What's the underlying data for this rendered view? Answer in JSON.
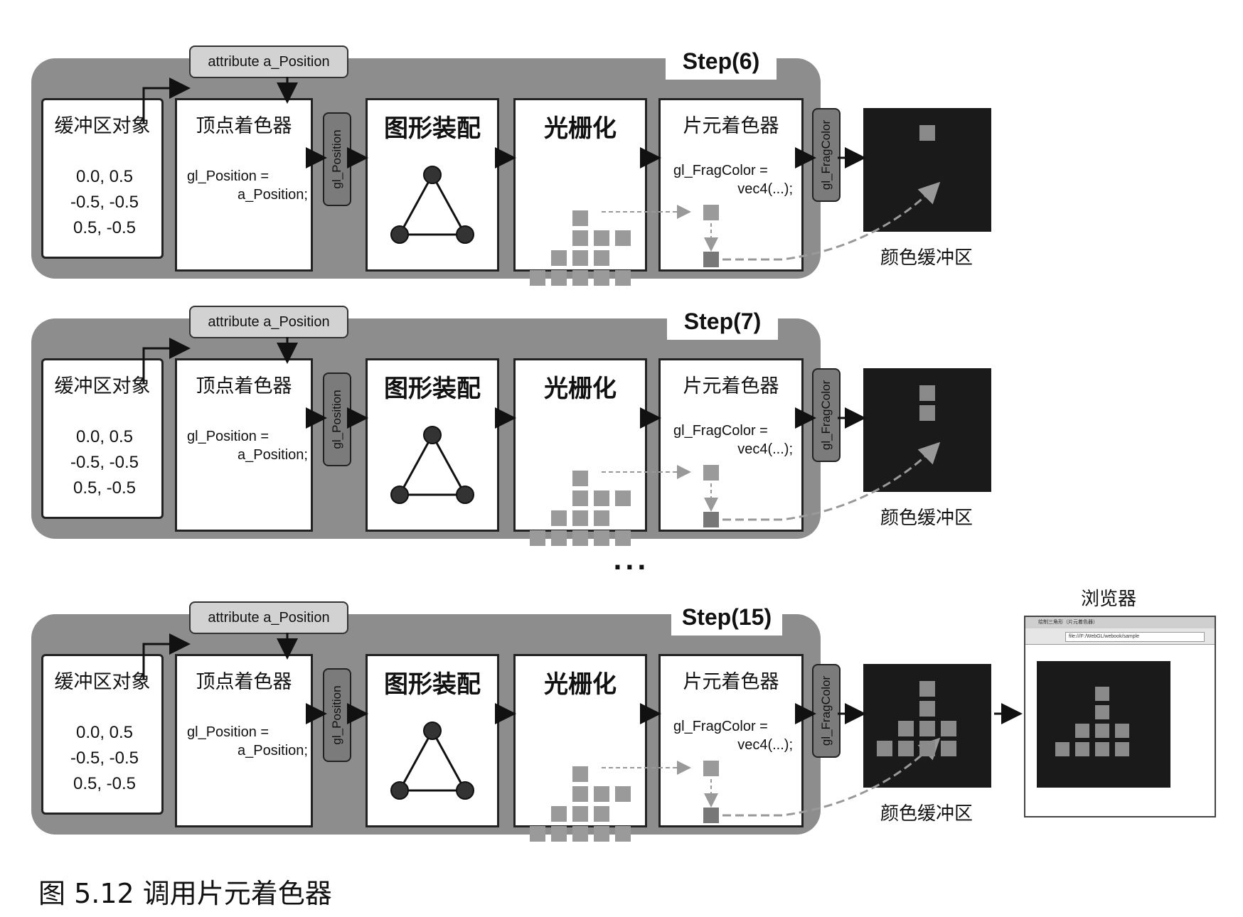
{
  "steps": [
    {
      "label": "Step(6)",
      "fragments_in_buffer": 1
    },
    {
      "label": "Step(7)",
      "fragments_in_buffer": 2
    },
    {
      "label": "Step(15)",
      "fragments_in_buffer": 9
    }
  ],
  "labels": {
    "attribute": "attribute a_Position",
    "buffer_object": "缓冲区对象",
    "buffer_values": [
      "0.0,  0.5",
      "-0.5, -0.5",
      "0.5, -0.5"
    ],
    "vertex_shader": "顶点着色器",
    "vs_code_line1": "gl_Position =",
    "vs_code_line2": "a_Position;",
    "gl_position": "gl_Position",
    "primitive_assembly": "图形装配",
    "rasterization": "光栅化",
    "fragment_shader": "片元着色器",
    "fs_code_line1": "gl_FragColor =",
    "fs_code_line2": "vec4(...);",
    "gl_fragcolor": "gl_FragColor",
    "color_buffer": "颜色缓冲区",
    "browser": "浏览器",
    "browser_tab": "绘制三角形（片元着色器）",
    "browser_url": "file:///F:/WebGL/webook/sample"
  },
  "ellipsis": "...",
  "caption": "图 5.12  调用片元着色器",
  "colors": {
    "band": "#8d8d8d",
    "fragment": "#8a8a8a",
    "buffer_bg": "#1a1a1a",
    "pill": "#7b7b7b"
  }
}
